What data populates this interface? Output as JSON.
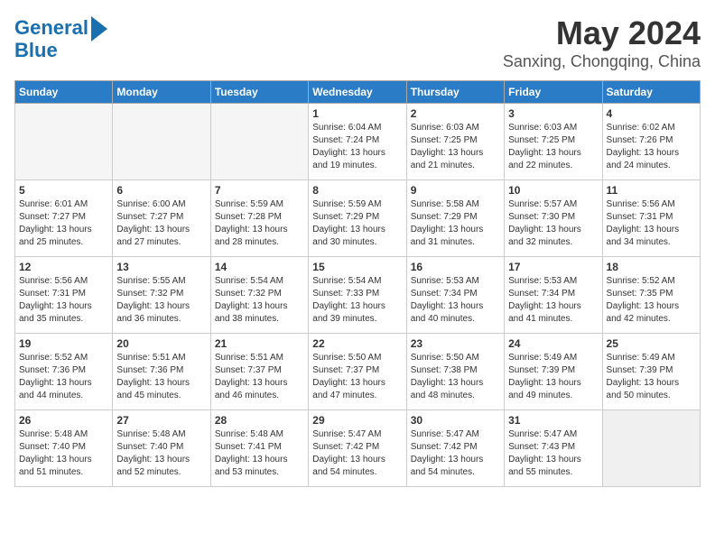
{
  "header": {
    "logo_line1": "General",
    "logo_line2": "Blue",
    "month_year": "May 2024",
    "location": "Sanxing, Chongqing, China"
  },
  "weekdays": [
    "Sunday",
    "Monday",
    "Tuesday",
    "Wednesday",
    "Thursday",
    "Friday",
    "Saturday"
  ],
  "weeks": [
    [
      {
        "day": "",
        "info": ""
      },
      {
        "day": "",
        "info": ""
      },
      {
        "day": "",
        "info": ""
      },
      {
        "day": "1",
        "info": "Sunrise: 6:04 AM\nSunset: 7:24 PM\nDaylight: 13 hours\nand 19 minutes."
      },
      {
        "day": "2",
        "info": "Sunrise: 6:03 AM\nSunset: 7:25 PM\nDaylight: 13 hours\nand 21 minutes."
      },
      {
        "day": "3",
        "info": "Sunrise: 6:03 AM\nSunset: 7:25 PM\nDaylight: 13 hours\nand 22 minutes."
      },
      {
        "day": "4",
        "info": "Sunrise: 6:02 AM\nSunset: 7:26 PM\nDaylight: 13 hours\nand 24 minutes."
      }
    ],
    [
      {
        "day": "5",
        "info": "Sunrise: 6:01 AM\nSunset: 7:27 PM\nDaylight: 13 hours\nand 25 minutes."
      },
      {
        "day": "6",
        "info": "Sunrise: 6:00 AM\nSunset: 7:27 PM\nDaylight: 13 hours\nand 27 minutes."
      },
      {
        "day": "7",
        "info": "Sunrise: 5:59 AM\nSunset: 7:28 PM\nDaylight: 13 hours\nand 28 minutes."
      },
      {
        "day": "8",
        "info": "Sunrise: 5:59 AM\nSunset: 7:29 PM\nDaylight: 13 hours\nand 30 minutes."
      },
      {
        "day": "9",
        "info": "Sunrise: 5:58 AM\nSunset: 7:29 PM\nDaylight: 13 hours\nand 31 minutes."
      },
      {
        "day": "10",
        "info": "Sunrise: 5:57 AM\nSunset: 7:30 PM\nDaylight: 13 hours\nand 32 minutes."
      },
      {
        "day": "11",
        "info": "Sunrise: 5:56 AM\nSunset: 7:31 PM\nDaylight: 13 hours\nand 34 minutes."
      }
    ],
    [
      {
        "day": "12",
        "info": "Sunrise: 5:56 AM\nSunset: 7:31 PM\nDaylight: 13 hours\nand 35 minutes."
      },
      {
        "day": "13",
        "info": "Sunrise: 5:55 AM\nSunset: 7:32 PM\nDaylight: 13 hours\nand 36 minutes."
      },
      {
        "day": "14",
        "info": "Sunrise: 5:54 AM\nSunset: 7:32 PM\nDaylight: 13 hours\nand 38 minutes."
      },
      {
        "day": "15",
        "info": "Sunrise: 5:54 AM\nSunset: 7:33 PM\nDaylight: 13 hours\nand 39 minutes."
      },
      {
        "day": "16",
        "info": "Sunrise: 5:53 AM\nSunset: 7:34 PM\nDaylight: 13 hours\nand 40 minutes."
      },
      {
        "day": "17",
        "info": "Sunrise: 5:53 AM\nSunset: 7:34 PM\nDaylight: 13 hours\nand 41 minutes."
      },
      {
        "day": "18",
        "info": "Sunrise: 5:52 AM\nSunset: 7:35 PM\nDaylight: 13 hours\nand 42 minutes."
      }
    ],
    [
      {
        "day": "19",
        "info": "Sunrise: 5:52 AM\nSunset: 7:36 PM\nDaylight: 13 hours\nand 44 minutes."
      },
      {
        "day": "20",
        "info": "Sunrise: 5:51 AM\nSunset: 7:36 PM\nDaylight: 13 hours\nand 45 minutes."
      },
      {
        "day": "21",
        "info": "Sunrise: 5:51 AM\nSunset: 7:37 PM\nDaylight: 13 hours\nand 46 minutes."
      },
      {
        "day": "22",
        "info": "Sunrise: 5:50 AM\nSunset: 7:37 PM\nDaylight: 13 hours\nand 47 minutes."
      },
      {
        "day": "23",
        "info": "Sunrise: 5:50 AM\nSunset: 7:38 PM\nDaylight: 13 hours\nand 48 minutes."
      },
      {
        "day": "24",
        "info": "Sunrise: 5:49 AM\nSunset: 7:39 PM\nDaylight: 13 hours\nand 49 minutes."
      },
      {
        "day": "25",
        "info": "Sunrise: 5:49 AM\nSunset: 7:39 PM\nDaylight: 13 hours\nand 50 minutes."
      }
    ],
    [
      {
        "day": "26",
        "info": "Sunrise: 5:48 AM\nSunset: 7:40 PM\nDaylight: 13 hours\nand 51 minutes."
      },
      {
        "day": "27",
        "info": "Sunrise: 5:48 AM\nSunset: 7:40 PM\nDaylight: 13 hours\nand 52 minutes."
      },
      {
        "day": "28",
        "info": "Sunrise: 5:48 AM\nSunset: 7:41 PM\nDaylight: 13 hours\nand 53 minutes."
      },
      {
        "day": "29",
        "info": "Sunrise: 5:47 AM\nSunset: 7:42 PM\nDaylight: 13 hours\nand 54 minutes."
      },
      {
        "day": "30",
        "info": "Sunrise: 5:47 AM\nSunset: 7:42 PM\nDaylight: 13 hours\nand 54 minutes."
      },
      {
        "day": "31",
        "info": "Sunrise: 5:47 AM\nSunset: 7:43 PM\nDaylight: 13 hours\nand 55 minutes."
      },
      {
        "day": "",
        "info": ""
      }
    ]
  ]
}
